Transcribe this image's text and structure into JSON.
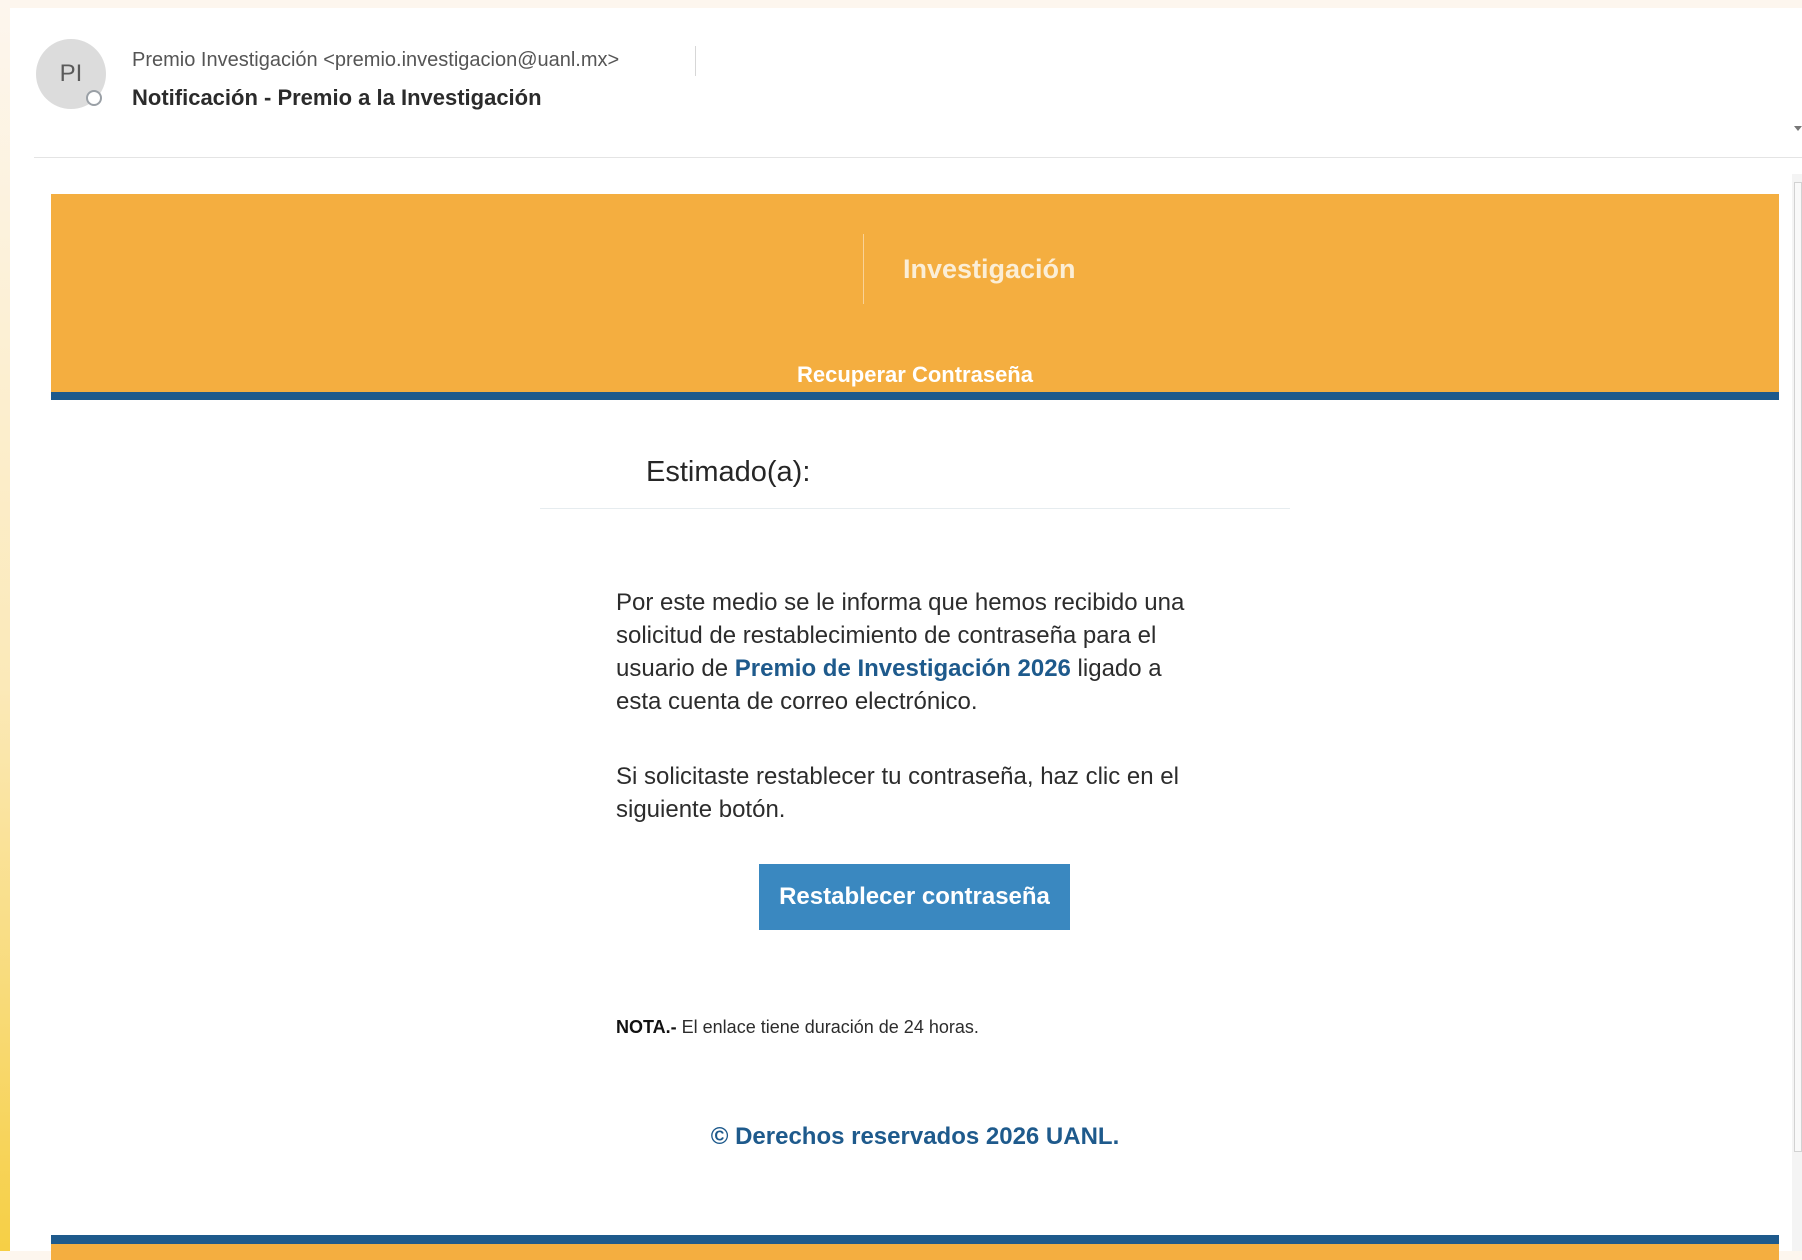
{
  "header": {
    "avatar_initials": "PI",
    "from": "Premio Investigación <premio.investigacion@uanl.mx>",
    "subject": "Notificación - Premio a la Investigación"
  },
  "banner": {
    "title": "Investigación",
    "subtitle": "Recuperar Contraseña"
  },
  "body": {
    "greeting": "Estimado(a):",
    "paragraph1_start": "Por este medio se le informa que hemos recibido una solicitud de restablecimiento de contraseña para el usuario de ",
    "paragraph1_highlight": "Premio de Investigación 2026",
    "paragraph1_end": " ligado a esta cuenta de correo electrónico.",
    "paragraph2": "Si solicitaste restablecer tu contraseña, haz clic en el siguiente botón.",
    "button_label": "Restablecer contraseña",
    "note_label": "NOTA.-",
    "note_text": " El enlace tiene duración de 24 horas.",
    "copyright": "© Derechos reservados 2026 UANL."
  },
  "colors": {
    "banner_orange": "#f4ae40",
    "accent_blue": "#1e5a8c",
    "button_blue": "#3a88c0"
  }
}
